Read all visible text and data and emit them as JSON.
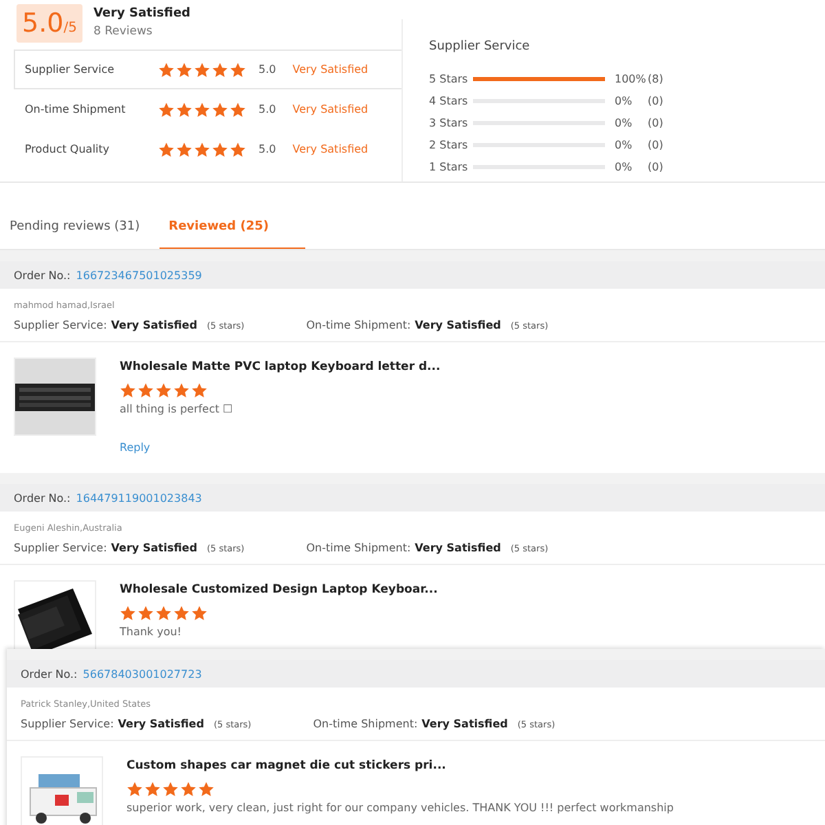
{
  "summary": {
    "score": "5.0",
    "out_of": "/5",
    "title": "Very Satisfied",
    "reviews": "8 Reviews",
    "ratings": [
      {
        "label": "Supplier Service",
        "stars": 5,
        "value": "5.0",
        "verdict": "Very Satisfied",
        "selected": true
      },
      {
        "label": "On-time Shipment",
        "stars": 5,
        "value": "5.0",
        "verdict": "Very Satisfied",
        "selected": false
      },
      {
        "label": "Product Quality",
        "stars": 5,
        "value": "5.0",
        "verdict": "Very Satisfied",
        "selected": false
      }
    ]
  },
  "breakdown": {
    "title": "Supplier Service",
    "rows": [
      {
        "label": "5 Stars",
        "level": 1,
        "percent": "100%",
        "count": "(8)"
      },
      {
        "label": "4 Stars",
        "level": 0,
        "percent": "0%",
        "count": "(0)"
      },
      {
        "label": "3 Stars",
        "level": 0,
        "percent": "0%",
        "count": "(0)"
      },
      {
        "label": "2 Stars",
        "level": 0,
        "percent": "0%",
        "count": "(0)"
      },
      {
        "label": "1 Stars",
        "level": 0,
        "percent": "0%",
        "count": "(0)"
      }
    ]
  },
  "tabs": [
    {
      "label": "Pending reviews (31)",
      "selected": false
    },
    {
      "label": "Reviewed (25)",
      "selected": true
    }
  ],
  "orders": [
    {
      "order_label": "Order No.:",
      "order_no": "166723467501025359",
      "buyer": "mahmod hamad,Israel",
      "supplier_label": "Supplier Service:",
      "supplier_value": "Very Satisfied",
      "supplier_stars": "(5 stars)",
      "shipment_label": "On-time Shipment:",
      "shipment_value": "Very Satisfied",
      "shipment_stars": "(5 stars)",
      "product": "Wholesale Matte PVC laptop Keyboard letter d...",
      "stars": 5,
      "comment": "all thing is perfect ☐",
      "reply": "Reply"
    },
    {
      "order_label": "Order No.:",
      "order_no": "164479119001023843",
      "buyer": "Eugeni Aleshin,Australia",
      "supplier_label": "Supplier Service:",
      "supplier_value": "Very Satisfied",
      "supplier_stars": "(5 stars)",
      "shipment_label": "On-time Shipment:",
      "shipment_value": "Very Satisfied",
      "shipment_stars": "(5 stars)",
      "product": "Wholesale Customized Design Laptop Keyboar...",
      "stars": 5,
      "comment": "Thank you!"
    },
    {
      "order_label": "Order No.:",
      "order_no": "56678403001027723",
      "buyer": "Patrick Stanley,United States",
      "supplier_label": "Supplier Service:",
      "supplier_value": "Very Satisfied",
      "supplier_stars": "(5 stars)",
      "shipment_label": "On-time Shipment:",
      "shipment_value": "Very Satisfied",
      "shipment_stars": "(5 stars)",
      "product": "Custom shapes car magnet die cut stickers pri...",
      "stars": 5,
      "comment": "superior work, very clean, just right for our company vehicles. THANK YOU !!!  perfect workmanship"
    }
  ]
}
